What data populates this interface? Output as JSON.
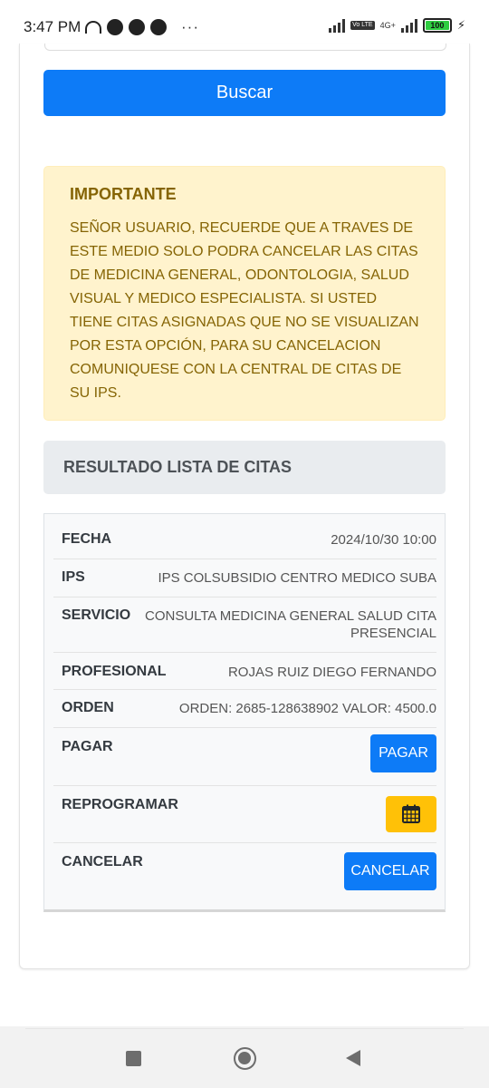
{
  "status_bar": {
    "time": "3:47 PM",
    "more": "···",
    "volte": "Vo LTE",
    "network": "4G+",
    "battery": "100"
  },
  "search": {
    "button_label": "Buscar"
  },
  "alert": {
    "title": "IMPORTANTE",
    "body": "SEÑOR USUARIO, RECUERDE QUE A TRAVES DE ESTE MEDIO SOLO PODRA CANCELAR LAS CITAS DE MEDICINA GENERAL, ODONTOLOGIA, SALUD VISUAL Y MEDICO ESPECIALISTA. SI USTED TIENE CITAS ASIGNADAS QUE NO SE VISUALIZAN POR ESTA OPCIÓN, PARA SU CANCELACION COMUNIQUESE CON LA CENTRAL DE CITAS DE SU IPS."
  },
  "results": {
    "heading": "RESULTADO LISTA DE CITAS",
    "fecha_label": "FECHA",
    "fecha_value": "2024/10/30 10:00",
    "ips_label": "IPS",
    "ips_value": "IPS COLSUBSIDIO CENTRO MEDICO SUBA",
    "servicio_label": "SERVICIO",
    "servicio_line1": "CONSULTA MEDICINA GENERAL SALUD CITA",
    "servicio_line2": "PRESENCIAL",
    "profesional_label": "PROFESIONAL",
    "profesional_value": "ROJAS RUIZ DIEGO FERNANDO",
    "orden_label": "ORDEN",
    "orden_value": "ORDEN: 2685-128638902 VALOR: 4500.0",
    "pagar_label": "PAGAR",
    "pagar_button": "PAGAR",
    "reprogramar_label": "REPROGRAMAR",
    "reprogramar_icon": "calendar-icon",
    "cancelar_label": "CANCELAR",
    "cancelar_button": "CANCELAR"
  },
  "colors": {
    "primary": "#0d7bf7",
    "warning_bg": "#fff3cd",
    "warning_text": "#856404",
    "calendar_button": "#ffc107"
  }
}
